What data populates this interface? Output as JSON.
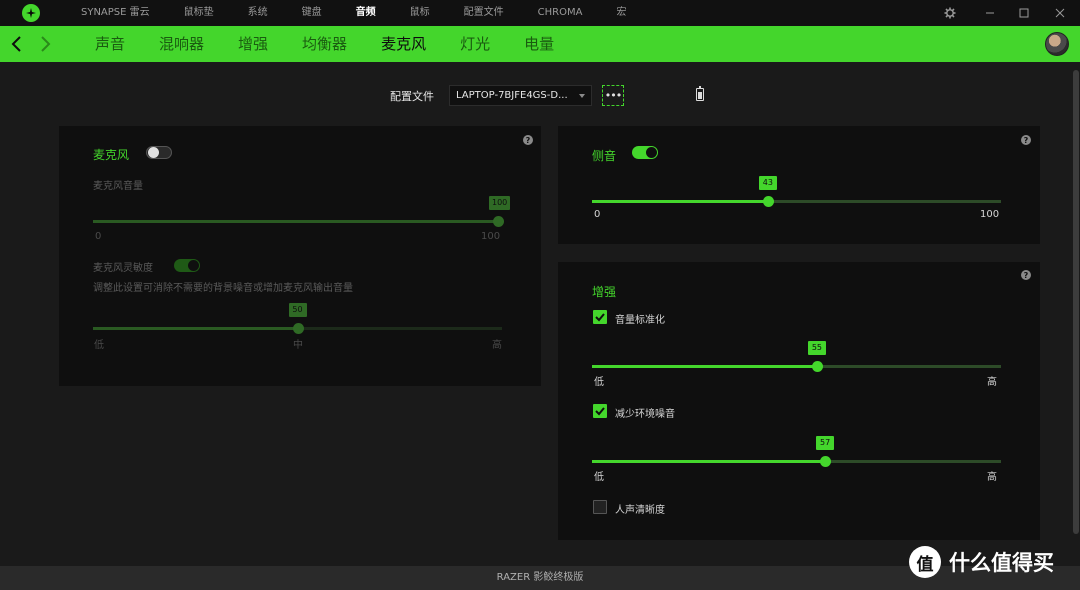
{
  "topnav": {
    "items": [
      "SYNAPSE 雷云",
      "鼠标垫",
      "系统",
      "键盘",
      "音频",
      "鼠标",
      "配置文件",
      "CHROMA",
      "宏"
    ],
    "active_index": 4
  },
  "subnav": {
    "tabs": [
      "声音",
      "混响器",
      "增强",
      "均衡器",
      "麦克风",
      "灯光",
      "电量"
    ],
    "active_index": 4
  },
  "profile": {
    "label": "配置文件",
    "value": "LAPTOP-7BJFE4GS-D...",
    "more": "•••"
  },
  "mic_panel": {
    "help": "?",
    "title": "麦克风",
    "toggle_on": false,
    "volume_label": "麦克风音量",
    "volume": {
      "value": 100,
      "min": 0,
      "max": 100,
      "bubble": "100",
      "min_label": "0",
      "max_label": "100"
    },
    "sensitivity_label": "麦克风灵敏度",
    "sensitivity_toggle_on": true,
    "sensitivity_desc": "调整此设置可消除不需要的背景噪音或增加麦克风输出音量",
    "sensitivity": {
      "value": 50,
      "min": 0,
      "max": 100,
      "bubble": "50",
      "min_label": "低",
      "mid_label": "中",
      "max_label": "高"
    }
  },
  "sidetone_panel": {
    "help": "?",
    "title": "侧音",
    "toggle_on": true,
    "slider": {
      "value": 43,
      "min": 0,
      "max": 100,
      "bubble": "43",
      "min_label": "0",
      "max_label": "100"
    }
  },
  "enhance_panel": {
    "help": "?",
    "title": "增强",
    "volume_norm": {
      "label": "音量标准化",
      "checked": true,
      "slider": {
        "value": 55,
        "min": 0,
        "max": 100,
        "bubble": "55",
        "min_label": "低",
        "max_label": "高"
      }
    },
    "noise_reduction": {
      "label": "减少环境噪音",
      "checked": true,
      "slider": {
        "value": 57,
        "min": 0,
        "max": 100,
        "bubble": "57",
        "min_label": "低",
        "max_label": "高"
      }
    },
    "voice_clarity": {
      "label": "人声清晰度",
      "checked": false
    }
  },
  "footer": {
    "text": "RAZER 影鲛终极版"
  },
  "watermark": {
    "glyph": "值",
    "text": "什么值得买"
  },
  "colors": {
    "accent": "#44d62c",
    "panel": "#0f0f0f",
    "background": "#1a1a1a",
    "titlebar": "#111111"
  }
}
